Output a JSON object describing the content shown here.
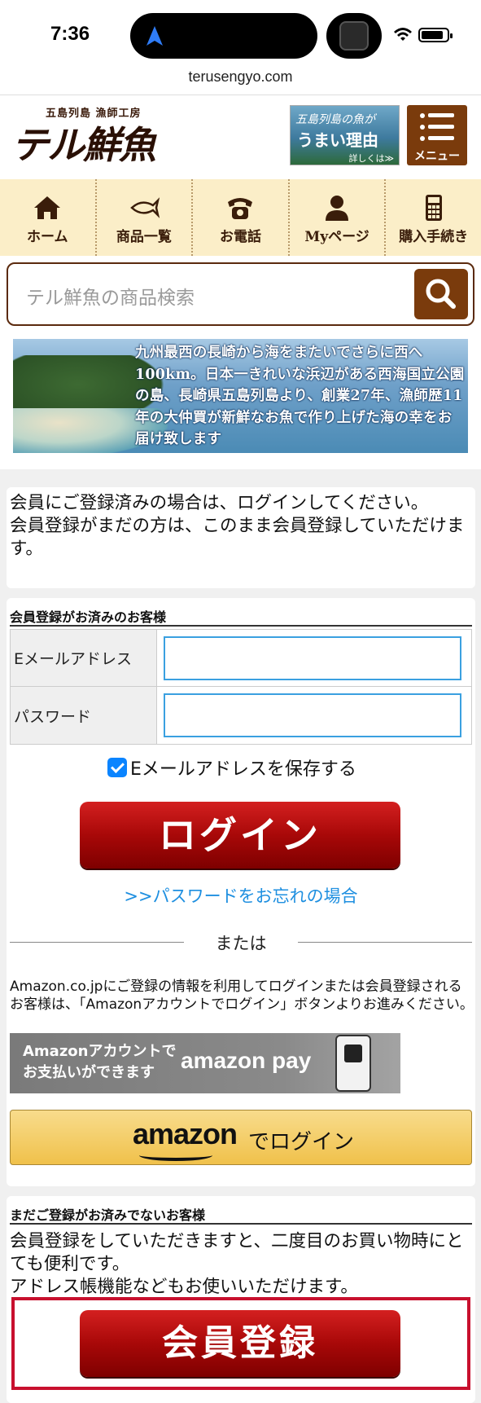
{
  "status_bar": {
    "time": "7:36"
  },
  "browser": {
    "url": "terusengyo.com"
  },
  "header": {
    "logo_small": "五島列島 漁師工房",
    "logo_big": "テル鮮魚",
    "banner_line1": "五島列島の魚が",
    "banner_line2": "うまい理由",
    "banner_line3": "詳しくは≫",
    "menu_label": "メニュー"
  },
  "nav": [
    {
      "label": "ホーム",
      "icon": "home-icon"
    },
    {
      "label": "商品一覧",
      "icon": "fish-icon"
    },
    {
      "label": "お電話",
      "icon": "phone-icon"
    },
    {
      "label": "Myページ",
      "icon": "user-icon"
    },
    {
      "label": "購入手続き",
      "icon": "calculator-icon"
    }
  ],
  "search": {
    "placeholder": "テル鮮魚の商品検索"
  },
  "promo_banner": {
    "text": "九州最西の長崎から海をまたいでさらに西へ100km。日本一きれいな浜辺がある西海国立公園の島、長崎県五島列島より、創業27年、漁師歴11年の大仲買が新鮮なお魚で作り上げた海の幸をお届け致します"
  },
  "info": {
    "text": "会員にご登録済みの場合は、ログインしてください。\n会員登録がまだの方は、このまま会員登録していただけます。"
  },
  "login": {
    "section_title": "会員登録がお済みのお客様",
    "email_label": "Eメールアドレス",
    "password_label": "パスワード",
    "remember_label": "Eメールアドレスを保存する",
    "login_button": "ログイン",
    "forgot_link": ">>パスワードをお忘れの場合",
    "or_label": "または",
    "amazon_note": "Amazon.co.jpにご登録の情報を利用してログインまたは会員登録されるお客様は、「Amazonアカウントでログイン」ボタンよりお進みください。",
    "amazon_pay_left": "Amazonアカウントで\nお支払いができます",
    "amazon_pay_right": "amazon pay",
    "amazon_login_logo": "amazon",
    "amazon_login_suffix": "でログイン"
  },
  "register": {
    "section_title": "まだご登録がお済みでないお客様",
    "text": "会員登録をしていただきますと、二度目のお買い物時にとても便利です。\nアドレス帳機能などもお使いいただけます。",
    "button": "会員登録"
  },
  "colors": {
    "brand_brown": "#7a3b0c",
    "nav_bg": "#fbeec8",
    "button_red": "#a80808",
    "link_blue": "#1e8fe0",
    "highlight_red": "#c8102e"
  }
}
